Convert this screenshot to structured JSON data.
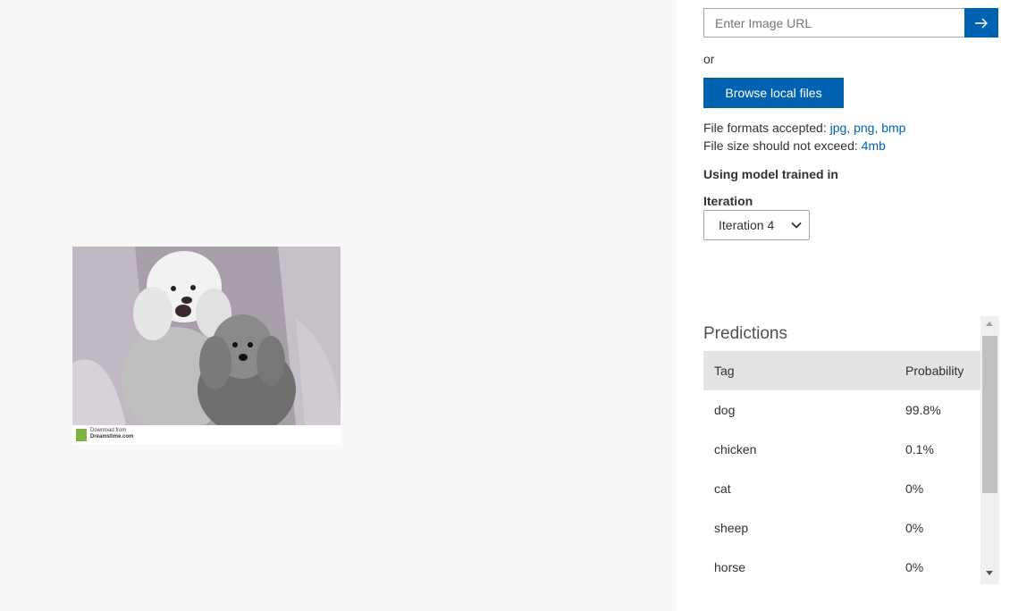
{
  "url_input": {
    "placeholder": "Enter Image URL",
    "value": ""
  },
  "icons": {
    "submit": "arrow-right-icon",
    "dropdown": "chevron-down-icon"
  },
  "or_text": "or",
  "browse_button": "Browse local files",
  "file_formats": {
    "label": "File formats accepted:",
    "formats": "jpg, png, bmp"
  },
  "file_size": {
    "label": "File size should not exceed:",
    "limit": "4mb"
  },
  "model_text": "Using model trained in",
  "iteration": {
    "label": "Iteration",
    "selected": "Iteration 4"
  },
  "preview_image": {
    "watermark": "Download from",
    "watermark_site": "Dreamstime.com"
  },
  "predictions": {
    "title": "Predictions",
    "columns": [
      "Tag",
      "Probability"
    ],
    "rows": [
      {
        "tag": "dog",
        "probability": "99.8%"
      },
      {
        "tag": "chicken",
        "probability": "0.1%"
      },
      {
        "tag": "cat",
        "probability": "0%"
      },
      {
        "tag": "sheep",
        "probability": "0%"
      },
      {
        "tag": "horse",
        "probability": "0%"
      }
    ]
  },
  "colors": {
    "accent": "#0063b1",
    "left_background": "#f8f8f8",
    "table_header": "#e3e3e3"
  }
}
